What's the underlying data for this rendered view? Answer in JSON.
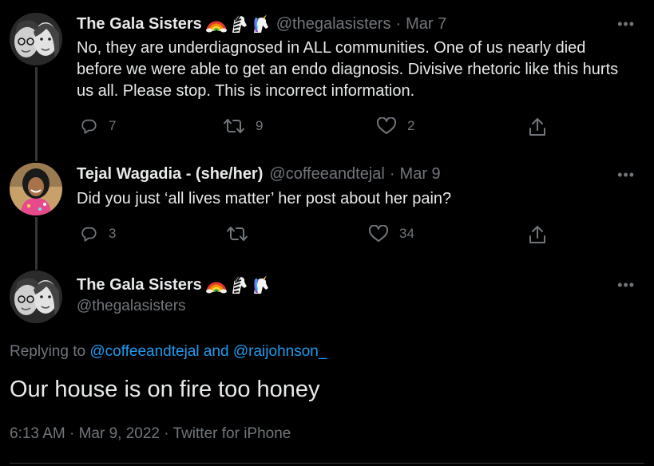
{
  "tweets": [
    {
      "name": "The Gala Sisters",
      "handle": "@thegalasisters",
      "separator": "·",
      "date": "Mar 7",
      "more": "•••",
      "text": "No, they are underdiagnosed in ALL communities. One of us nearly died before we were able to get an endo diagnosis. Divisive rhetoric like this hurts us all. Please stop. This is incorrect information.",
      "replies": "7",
      "retweets": "9",
      "likes": "2"
    },
    {
      "name": "Tejal Wagadia - (she/her)",
      "handle": "@coffeeandtejal",
      "separator": "·",
      "date": "Mar 9",
      "more": "•••",
      "text": "Did you just ‘all lives matter’ her post about her pain?",
      "replies": "3",
      "retweets": "",
      "likes": "34"
    }
  ],
  "focused": {
    "name": "The Gala Sisters",
    "handle": "@thegalasisters",
    "more": "•••",
    "replying_prefix": "Replying to",
    "mention1": "@coffeeandtejal",
    "and": "and",
    "mention2": "@raijohnson_",
    "text": "Our house is on fire too honey",
    "meta": "6:13 AM · Mar 9, 2022 · Twitter for iPhone"
  },
  "icons": {
    "reply": "reply-icon",
    "retweet": "retweet-icon",
    "like": "heart-icon",
    "share": "share-icon",
    "emojis": [
      "rainbow-emoji",
      "zebra-emoji",
      "unicorn-emoji"
    ]
  },
  "colors": {
    "background": "#000000",
    "text": "#e7e9ea",
    "muted": "#71767b",
    "link": "#1d9bf0",
    "thread_line": "#333639"
  }
}
